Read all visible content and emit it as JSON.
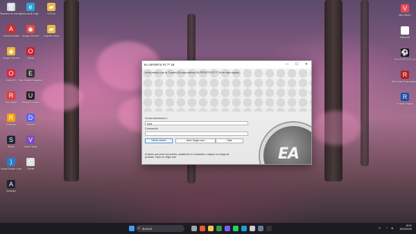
{
  "desktop": {
    "icons_left": [
      {
        "label": "Papelera de reciclaje",
        "icon": "recycle-bin-icon",
        "color": "#c9d2dc",
        "glyph": "🗑"
      },
      {
        "label": "Adobe Acrobat",
        "icon": "acrobat-icon",
        "color": "#d12b2b",
        "glyph": "A"
      },
      {
        "label": "Google Chrome",
        "icon": "chrome-icon",
        "color": "#e9b52a",
        "glyph": "◉"
      },
      {
        "label": "Opera GX",
        "icon": "opera-icon",
        "color": "#d42a3c",
        "glyph": "O"
      },
      {
        "label": "Riot Client",
        "icon": "riot-icon",
        "color": "#e33b3b",
        "glyph": "R"
      },
      {
        "label": "Rockstar",
        "icon": "rockstar-icon",
        "color": "#f6a200",
        "glyph": "R"
      },
      {
        "label": "Steam",
        "icon": "steam-icon",
        "color": "#1b2838",
        "glyph": "S"
      },
      {
        "label": "Visual Studio Code",
        "icon": "vscode-icon",
        "color": "#2c7bd0",
        "glyph": "⟩"
      },
      {
        "label": "Armoury",
        "icon": "armoury-icon",
        "color": "#223",
        "glyph": "A"
      }
    ],
    "icons_col2": [
      {
        "label": "Microsoft Edge",
        "icon": "edge-icon",
        "color": "#2ba3d9",
        "glyph": "e"
      },
      {
        "label": "Google Chrome",
        "icon": "chrome-icon-2",
        "color": "#e44b3c",
        "glyph": "◉"
      },
      {
        "label": "Opera",
        "icon": "opera-icon-2",
        "color": "#cc1f2d",
        "glyph": "O"
      },
      {
        "label": "Epic Games Launcher",
        "icon": "epic-icon",
        "color": "#333",
        "glyph": "E"
      },
      {
        "label": "Ubisoft Connect",
        "icon": "ubisoft-icon",
        "color": "#222",
        "glyph": "U"
      },
      {
        "label": "Discord",
        "icon": "discord-icon",
        "color": "#5865f2",
        "glyph": "D"
      },
      {
        "label": "Visual Studio",
        "icon": "visual-studio-icon",
        "color": "#7b4bbf",
        "glyph": "V"
      },
      {
        "label": "Cliente",
        "icon": "client-icon",
        "color": "#ddd",
        "glyph": "C"
      }
    ],
    "icons_col3": [
      {
        "label": "VSTree",
        "icon": "folder-icon",
        "color": "#e8b84a",
        "glyph": "▰"
      },
      {
        "label": "Carpeta nueva",
        "icon": "folder-icon-2",
        "color": "#e8b84a",
        "glyph": "▰"
      }
    ],
    "icons_right": [
      {
        "label": "VALORANT",
        "icon": "valorant-icon",
        "color": "#e84856",
        "glyph": "V"
      },
      {
        "label": "Valorant2",
        "icon": "valorant2-icon",
        "color": "#fff",
        "glyph": "▭"
      },
      {
        "label": "EA SPORTS FC 26",
        "icon": "ea-fc-icon",
        "color": "#111",
        "glyph": "⚽"
      },
      {
        "label": "Red Dead Redemption 2",
        "icon": "rdr2-icon",
        "color": "#b21f1f",
        "glyph": "R"
      },
      {
        "label": "Rocket League",
        "icon": "rocket-icon",
        "color": "#1d4fa3",
        "glyph": "R"
      }
    ]
  },
  "dialog": {
    "title": "EA SPORTS FC™ 26",
    "minimize": "—",
    "maximize": "☐",
    "close": "✕",
    "intro": "Inicia sesión con tu Cuenta EA para activar EA SPORTS FC™ 26 en este equipo.",
    "email_label": "Correo electrónico o",
    "email_value": "root",
    "password_label": "Contraseña",
    "password_value": "",
    "login_button": "Iniciar sesión",
    "origin_button": "Abrir Origin.com",
    "exit_button": "Salir",
    "note": "Si tienes que crear una cuenta, restablecer tu contraseña o canjear un código de producto, hazlo en Origin.com",
    "logo_text": "EA"
  },
  "taskbar": {
    "search_placeholder": "Buscar",
    "search_icon": "search-icon",
    "time": "18:01",
    "date": "25/03/2026",
    "apps": [
      {
        "icon": "windows-start-icon",
        "color": "#3aa0ff"
      },
      {
        "icon": "task-view-icon",
        "color": "#9aa"
      },
      {
        "icon": "brave-icon",
        "color": "#f05a28"
      },
      {
        "icon": "file-explorer-icon",
        "color": "#f2c24f"
      },
      {
        "icon": "chrome-icon",
        "color": "#2f9e44"
      },
      {
        "icon": "vpn-icon",
        "color": "#7c5cff"
      },
      {
        "icon": "whatsapp-icon",
        "color": "#25d366"
      },
      {
        "icon": "edge-icon",
        "color": "#1aa1d9"
      },
      {
        "icon": "settings-icon",
        "color": "#ccc"
      },
      {
        "icon": "steam-icon",
        "color": "#5c7e9e"
      },
      {
        "icon": "terminal-icon",
        "color": "#333"
      }
    ]
  }
}
